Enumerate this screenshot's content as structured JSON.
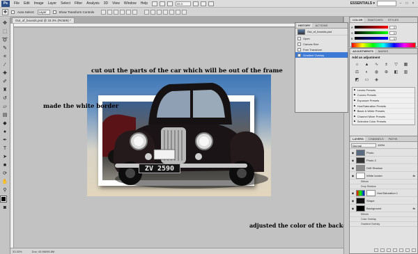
{
  "menubar": {
    "logo": "Ps",
    "items": [
      "File",
      "Edit",
      "Image",
      "Layer",
      "Select",
      "Filter",
      "Analysis",
      "3D",
      "View",
      "Window",
      "Help"
    ],
    "zoom": "33.3",
    "workspace": "ESSENTIALS ▾"
  },
  "options": {
    "auto_select_label": "Auto-Select:",
    "auto_select_value": "Layer",
    "transform_label": "Show Transform Controls"
  },
  "document": {
    "tab_title": "Out_of_bounds.psd @ 33.3% (RGB/8) *",
    "status_zoom": "33.33%",
    "status_doc": "Doc: 43.5M/95.8M"
  },
  "annotations": {
    "cutout": "cut out the parts of the car which will be out of the frame",
    "border": "made the white border",
    "background": "adjusted the color of the background"
  },
  "plate": "ZV 2590",
  "history": {
    "tabs": [
      "HISTORY",
      "ACTIONS"
    ],
    "snapshot": "Out_of_bounds.psd",
    "items": [
      "Open",
      "Canvas Size",
      "Free Transform",
      "Gradient Overlay"
    ]
  },
  "color": {
    "tabs": [
      "COLOR",
      "SWATCHES",
      "STYLES"
    ],
    "rows": [
      {
        "label": "R",
        "value": "0"
      },
      {
        "label": "G",
        "value": "0"
      },
      {
        "label": "B",
        "value": "0"
      }
    ]
  },
  "adjustments": {
    "tabs": [
      "ADJUSTMENTS",
      "MASKS"
    ],
    "title": "Add an adjustment",
    "presets": [
      "Levels Presets",
      "Curves Presets",
      "Exposure Presets",
      "Hue/Saturation Presets",
      "Black & White Presets",
      "Channel Mixer Presets",
      "Selective Color Presets"
    ]
  },
  "layers": {
    "tabs": [
      "LAYERS",
      "CHANNELS",
      "PATHS"
    ],
    "blend": "Normal",
    "opacity": "100%",
    "items": [
      {
        "name": "Photo",
        "thumb": "#5a6a80",
        "fx": ""
      },
      {
        "name": "Photo 2",
        "thumb": "#333333",
        "fx": ""
      },
      {
        "name": "Drift Shadow",
        "thumb": "#8a8a8a",
        "fx": ""
      },
      {
        "name": "White border",
        "thumb": "#ffffff",
        "fx": "fx"
      }
    ],
    "white_effects": [
      "Effects",
      "Drop Shadow"
    ],
    "hue_layer": "Hue/Saturation 1",
    "more_items": [
      {
        "name": "Shape",
        "thumb": "#111111",
        "fx": ""
      },
      {
        "name": "Background",
        "thumb": "#000000",
        "fx": "fx"
      }
    ],
    "bg_effects": [
      "Effects",
      "Color Overlay",
      "Gradient Overlay"
    ]
  }
}
